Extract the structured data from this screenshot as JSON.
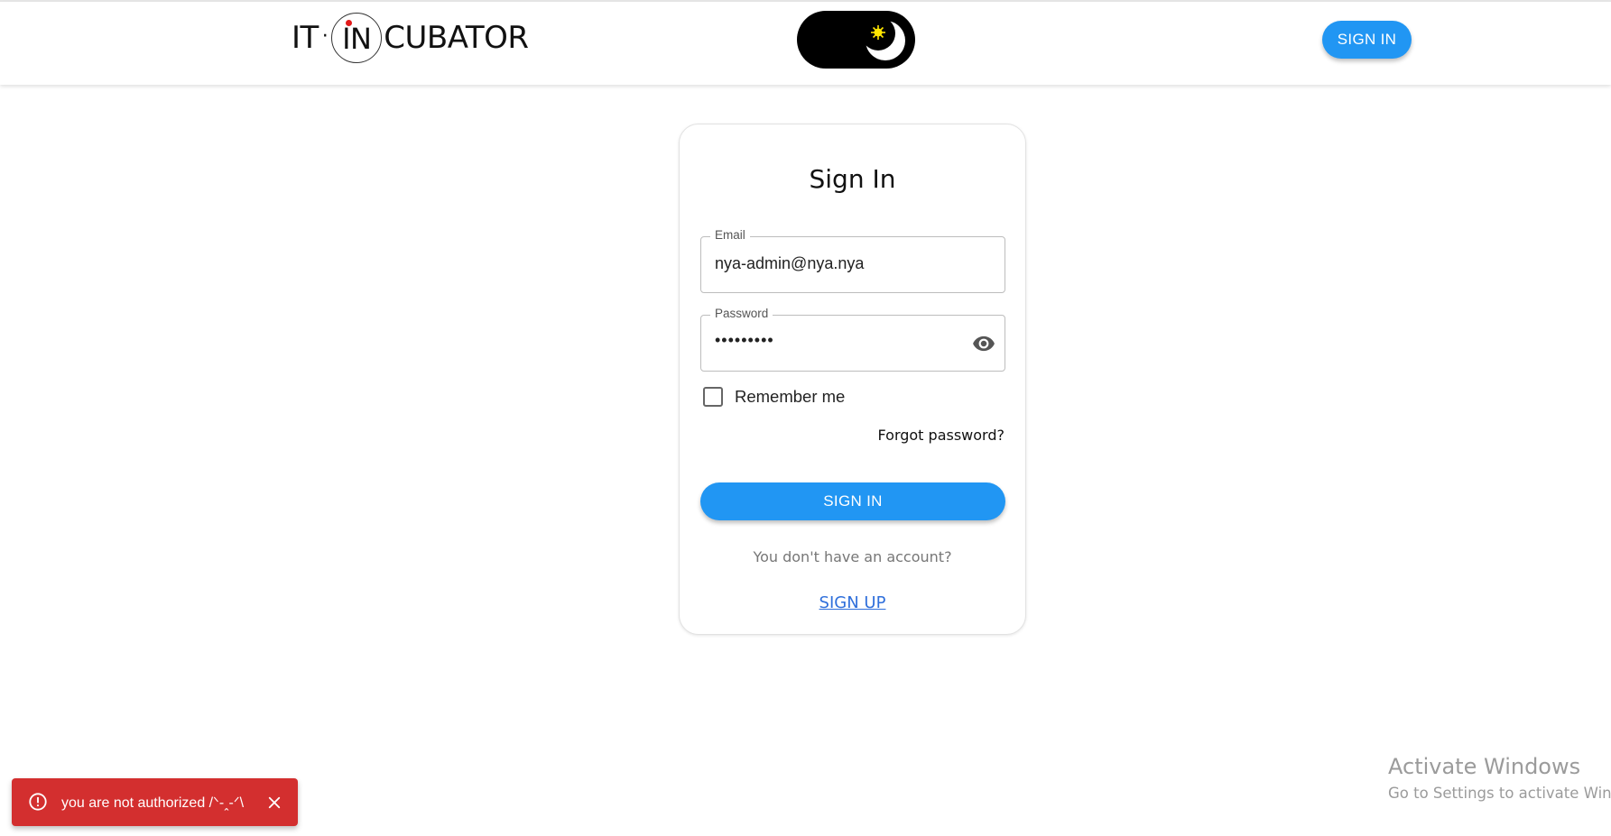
{
  "header": {
    "logo": {
      "left": "IT",
      "dot": "·",
      "ring": "IN",
      "right": "CUBATOR"
    },
    "theme_toggle": {
      "icons": [
        "sun-icon",
        "moon-icon"
      ]
    },
    "signin_label": "SIGN IN"
  },
  "form": {
    "title": "Sign In",
    "email": {
      "label": "Email",
      "value": "nya-admin@nya.nya"
    },
    "password": {
      "label": "Password",
      "value": "•••••••••"
    },
    "remember_label": "Remember me",
    "forgot_label": "Forgot password?",
    "submit_label": "SIGN IN",
    "no_account_text": "You don't have an account?",
    "signup_label": "SIGN UP"
  },
  "toast": {
    "message": "you are not authorized /ᐠ-ꞈ-ᐟ\\",
    "color": "#d32f2f"
  },
  "watermark": {
    "title": "Activate Windows",
    "subtitle": "Go to Settings to activate Windows."
  },
  "colors": {
    "primary": "#2196f3",
    "error": "#d32f2f",
    "link": "#2f6fdb"
  }
}
